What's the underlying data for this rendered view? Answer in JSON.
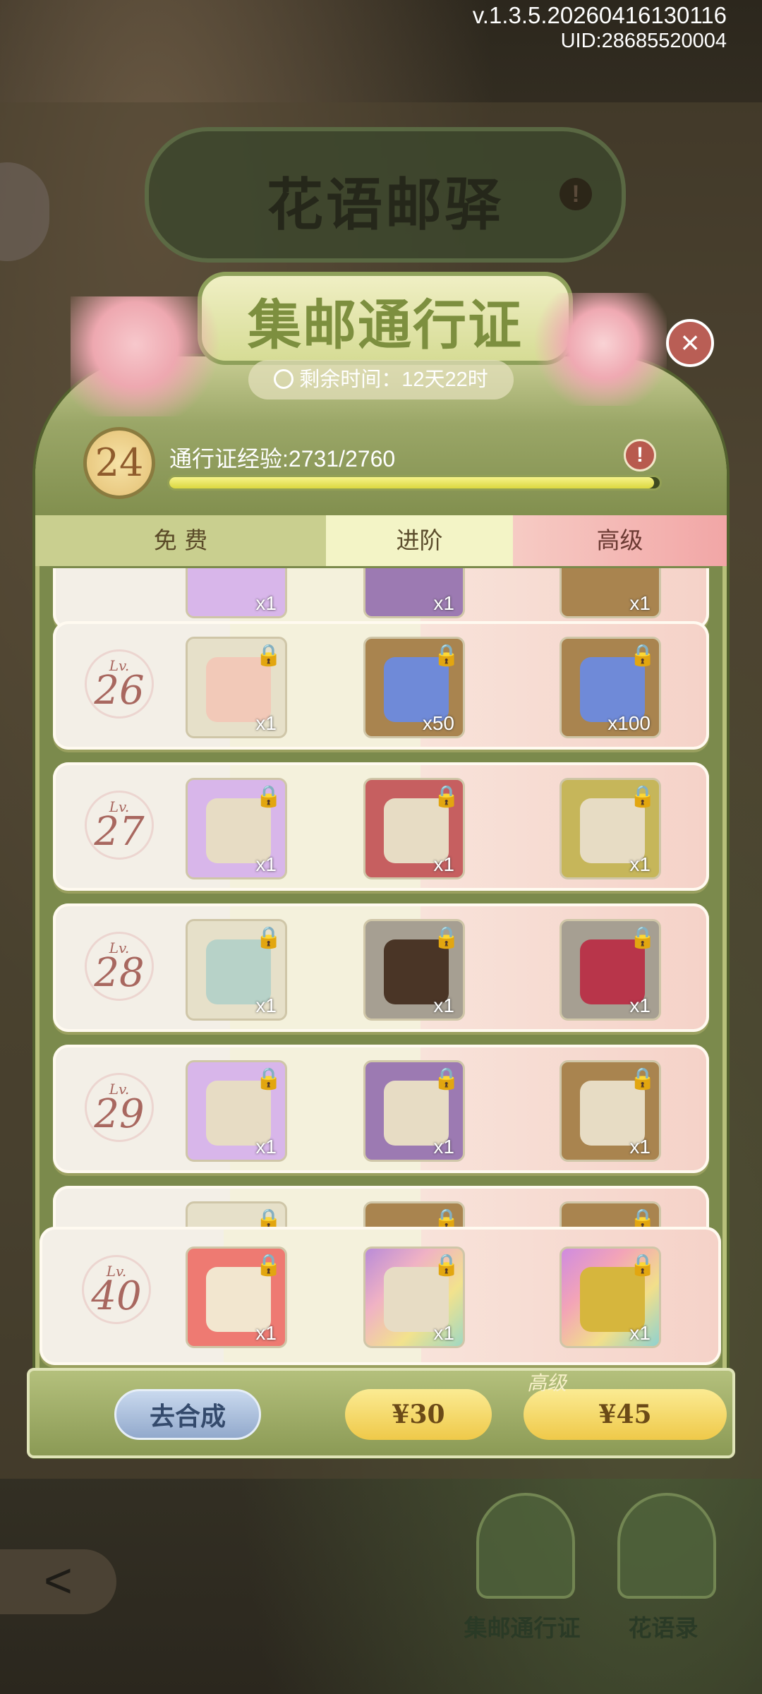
{
  "version": "v.1.3.5.20260416130116",
  "uid": "UID:28685520004",
  "background_title": "花语邮驿",
  "header": {
    "title": "集邮通行证",
    "time_label": "剩余时间：12天22时"
  },
  "exp": {
    "level": "24",
    "label": "通行证经验:2731/2760",
    "progress_fraction": 0.989
  },
  "tabs": {
    "free": "免 费",
    "advanced": "进阶",
    "premium": "高级"
  },
  "rows": [
    {
      "lv_prefix": "Lv.",
      "level": "",
      "free_qty": "x1",
      "adv_qty": "x1",
      "prem_qty": "x1"
    },
    {
      "lv_prefix": "Lv.",
      "level": "26",
      "free_qty": "x1",
      "adv_qty": "x50",
      "prem_qty": "x100"
    },
    {
      "lv_prefix": "Lv.",
      "level": "27",
      "free_qty": "x1",
      "adv_qty": "x1",
      "prem_qty": "x1"
    },
    {
      "lv_prefix": "Lv.",
      "level": "28",
      "free_qty": "x1",
      "adv_qty": "x1",
      "prem_qty": "x1"
    },
    {
      "lv_prefix": "Lv.",
      "level": "29",
      "free_qty": "x1",
      "adv_qty": "x1",
      "prem_qty": "x1"
    },
    {
      "lv_prefix": "Lv.",
      "level": "",
      "free_qty": "",
      "adv_qty": "",
      "prem_qty": ""
    },
    {
      "lv_prefix": "Lv.",
      "level": "40",
      "free_qty": "x1",
      "adv_qty": "x1",
      "prem_qty": "x1"
    }
  ],
  "footer": {
    "synthesize": "去合成",
    "price_advanced": "¥30",
    "price_premium": "¥45",
    "premium_tag": "高级"
  },
  "nav": {
    "back": "<",
    "pass": "集邮通行证",
    "flower_log": "花语录"
  },
  "icons": {
    "lock": "lock-icon",
    "close": "close-icon",
    "clock": "clock-icon",
    "warning": "exclamation-icon"
  }
}
